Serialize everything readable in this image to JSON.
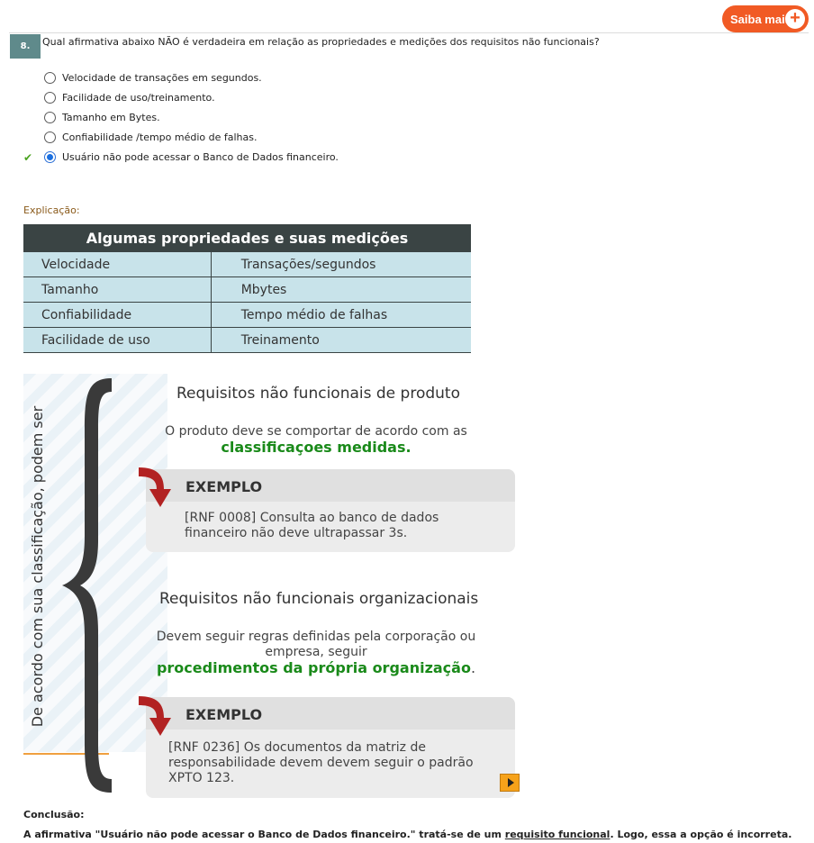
{
  "header": {
    "saiba_mais": "Saiba mais"
  },
  "question": {
    "number": "8.",
    "text": "Qual afirmativa abaixo NÃO é verdadeira em relação as propriedades e medições dos requisitos não funcionais?",
    "options": [
      {
        "label": "Velocidade de transações em segundos.",
        "selected": false,
        "correct": false
      },
      {
        "label": "Facilidade de uso/treinamento.",
        "selected": false,
        "correct": false
      },
      {
        "label": "Tamanho em Bytes.",
        "selected": false,
        "correct": false
      },
      {
        "label": "Confiabilidade /tempo médio de falhas.",
        "selected": false,
        "correct": false
      },
      {
        "label": "Usuário não pode acessar o Banco de Dados financeiro.",
        "selected": true,
        "correct": true
      }
    ]
  },
  "explanation_label": "Explicação:",
  "properties_table": {
    "title": "Algumas propriedades e suas medições",
    "rows": [
      [
        "Velocidade",
        "Transações/segundos"
      ],
      [
        "Tamanho",
        "Mbytes"
      ],
      [
        "Confiabilidade",
        "Tempo médio de falhas"
      ],
      [
        "Facilidade de uso",
        "Treinamento"
      ]
    ]
  },
  "diagram": {
    "vertical_text": "De acordo com sua classificação, podem ser",
    "product": {
      "title": "Requisitos não funcionais de produto",
      "desc": "O produto deve se comportar de acordo com as",
      "highlight": "classificaçoes medidas.",
      "example_title": "EXEMPLO",
      "example_line1": "[RNF 0008] Consulta ao banco de dados",
      "example_line2": "financeiro não deve ultrapassar 3s."
    },
    "organizational": {
      "title": "Requisitos não funcionais organizacionais",
      "desc_line1": "Devem seguir regras definidas pela corporação ou",
      "desc_line2": "empresa, seguir",
      "highlight": "procedimentos da própria organização",
      "highlight_suffix": ".",
      "example_title": "EXEMPLO",
      "example_line1": "[RNF 0236] Os documentos da matriz de",
      "example_line2": "responsabilidade devem devem seguir o padrão",
      "example_line3": "XPTO 123."
    }
  },
  "conclusion": {
    "title": "Conclusão:",
    "before": "A afirmativa \"Usuário não pode acessar o Banco de Dados financeiro.\" tratá-se de um ",
    "link": "requisito funcional",
    "after": ". Logo, essa a opção é incorreta."
  },
  "colors": {
    "accent": "#f15a24",
    "question_badge": "#5f8a8b",
    "correct_check": "#4aa320",
    "highlight_green": "#1a8a1a",
    "table_header": "#3a4444",
    "table_cell": "#c8e3ea"
  }
}
